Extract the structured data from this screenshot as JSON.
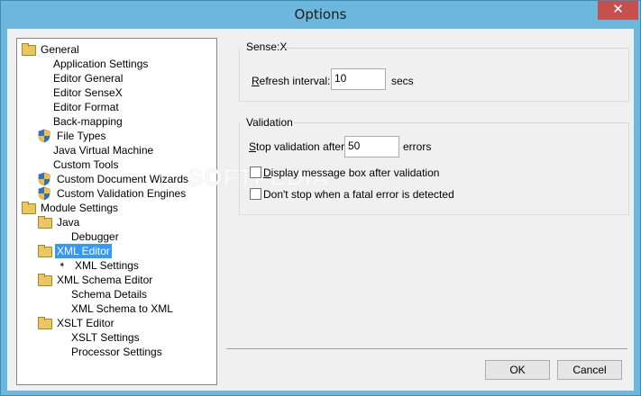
{
  "window": {
    "title": "Options",
    "close_glyph": "✕"
  },
  "tree": [
    {
      "label": "General",
      "icon": "folder-icon",
      "depth": 0
    },
    {
      "label": "Application Settings",
      "icon": "",
      "depth": 1
    },
    {
      "label": "Editor General",
      "icon": "",
      "depth": 1
    },
    {
      "label": "Editor SenseX",
      "icon": "",
      "depth": 1
    },
    {
      "label": "Editor Format",
      "icon": "",
      "depth": 1
    },
    {
      "label": "Back-mapping",
      "icon": "",
      "depth": 1
    },
    {
      "label": "File Types",
      "icon": "shield-icon",
      "depth": 1
    },
    {
      "label": "Java Virtual Machine",
      "icon": "",
      "depth": 1
    },
    {
      "label": "Custom Tools",
      "icon": "",
      "depth": 1
    },
    {
      "label": "Custom Document Wizards",
      "icon": "shield-icon",
      "depth": 1
    },
    {
      "label": "Custom Validation Engines",
      "icon": "shield-icon",
      "depth": 1
    },
    {
      "label": "Module Settings",
      "icon": "folder-icon",
      "depth": 0
    },
    {
      "label": "Java",
      "icon": "folder-icon",
      "depth": 1
    },
    {
      "label": "Debugger",
      "icon": "",
      "depth": 2
    },
    {
      "label": "XML Editor",
      "icon": "folder-icon",
      "depth": 1,
      "selected": true
    },
    {
      "label": "XML Settings",
      "icon": "arrow-icon",
      "depth": 2
    },
    {
      "label": "XML Schema Editor",
      "icon": "folder-icon",
      "depth": 1
    },
    {
      "label": "Schema Details",
      "icon": "",
      "depth": 2
    },
    {
      "label": "XML Schema to XML",
      "icon": "",
      "depth": 2
    },
    {
      "label": "XSLT Editor",
      "icon": "folder-icon",
      "depth": 1
    },
    {
      "label": "XSLT Settings",
      "icon": "",
      "depth": 2
    },
    {
      "label": "Processor Settings",
      "icon": "",
      "depth": 2
    }
  ],
  "sensex": {
    "title": "Sense:X",
    "refresh_label_u": "R",
    "refresh_label_rest": "efresh interval:",
    "refresh_value": "10",
    "refresh_unit": "secs"
  },
  "validation": {
    "title": "Validation",
    "stop_label_u": "S",
    "stop_label_rest": "top validation after:",
    "stop_value": "50",
    "stop_unit": "errors",
    "msgbox_label_u": "D",
    "msgbox_label_rest": "isplay message box after validation",
    "msgbox_checked": false,
    "fatal_label": "Don't stop when a fatal error is detected",
    "fatal_checked": false
  },
  "buttons": {
    "ok": "OK",
    "cancel": "Cancel"
  },
  "watermark": "SOFTPEDIA"
}
